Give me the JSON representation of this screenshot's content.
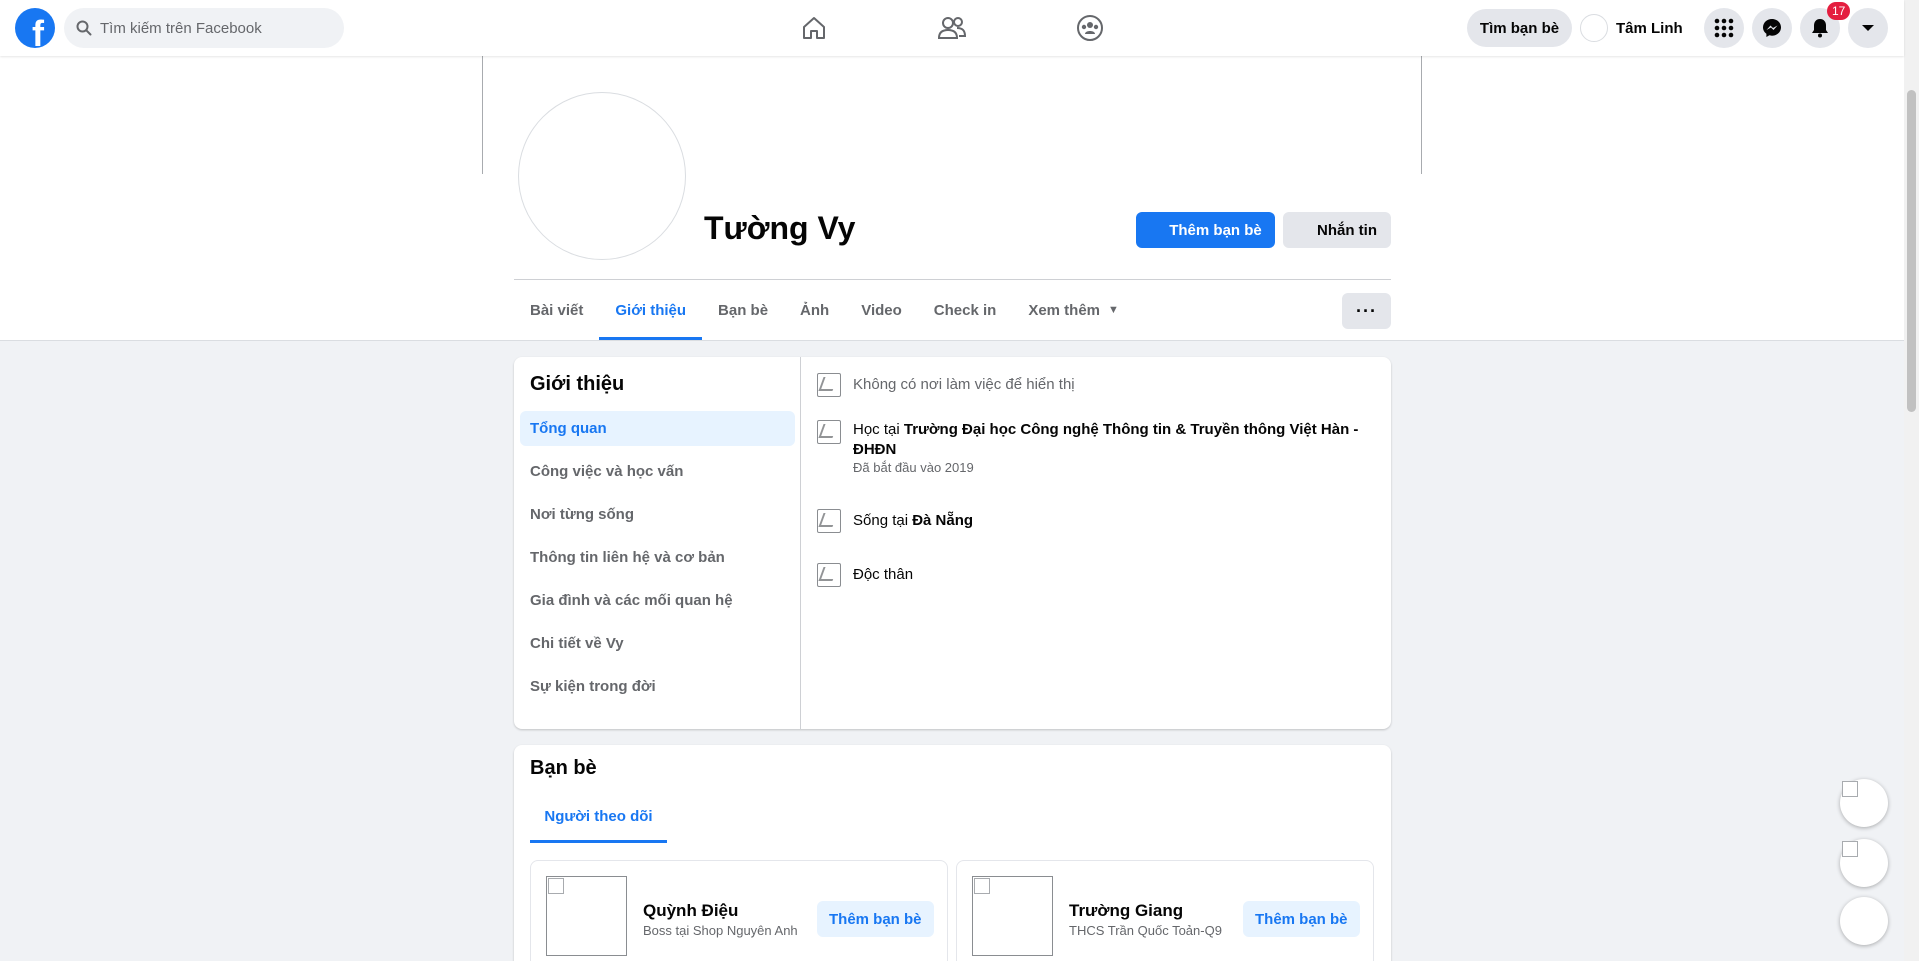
{
  "topbar": {
    "logo_letter": "f",
    "search_placeholder": "Tìm kiếm trên Facebook",
    "find_friends_label": "Tìm bạn bè",
    "user_name": "Tâm Linh",
    "notification_count": "17"
  },
  "profile": {
    "name": "Tường Vy",
    "add_friend_label": "Thêm bạn bè",
    "message_label": "Nhắn tin",
    "tabs": [
      {
        "label": "Bài viết"
      },
      {
        "label": "Giới thiệu"
      },
      {
        "label": "Bạn bè"
      },
      {
        "label": "Ảnh"
      },
      {
        "label": "Video"
      },
      {
        "label": "Check in"
      },
      {
        "label": "Xem thêm"
      }
    ],
    "more_label": "···"
  },
  "about": {
    "title": "Giới thiệu",
    "menu": [
      {
        "label": "Tổng quan"
      },
      {
        "label": "Công việc và học vấn"
      },
      {
        "label": "Nơi từng sống"
      },
      {
        "label": "Thông tin liên hệ và cơ bản"
      },
      {
        "label": "Gia đình và các mối quan hệ"
      },
      {
        "label": "Chi tiết về Vy"
      },
      {
        "label": "Sự kiện trong đời"
      }
    ],
    "no_work": "Không có nơi làm việc để hiển thị",
    "study_prefix": "Học tại ",
    "study_school": "Trường Đại học Công nghệ Thông tin & Truyền thông Việt Hàn - ĐHĐN",
    "study_since": "Đã bắt đầu vào 2019",
    "lives_prefix": "Sống tại ",
    "lives_city": "Đà Nẵng",
    "relationship": "Độc thân"
  },
  "friends": {
    "title": "Bạn bè",
    "tab_label": "Người theo dõi",
    "items": [
      {
        "name": "Quỳnh Điệu",
        "subtitle": "Boss tại Shop Nguyên Anh",
        "button": "Thêm bạn bè"
      },
      {
        "name": "Trường Giang",
        "subtitle": "THCS Trần Quốc Toản-Q9",
        "button": "Thêm bạn bè"
      }
    ]
  },
  "colors": {
    "brand": "#1877f2",
    "background": "#f0f2f5",
    "badge": "#e41e3f"
  }
}
